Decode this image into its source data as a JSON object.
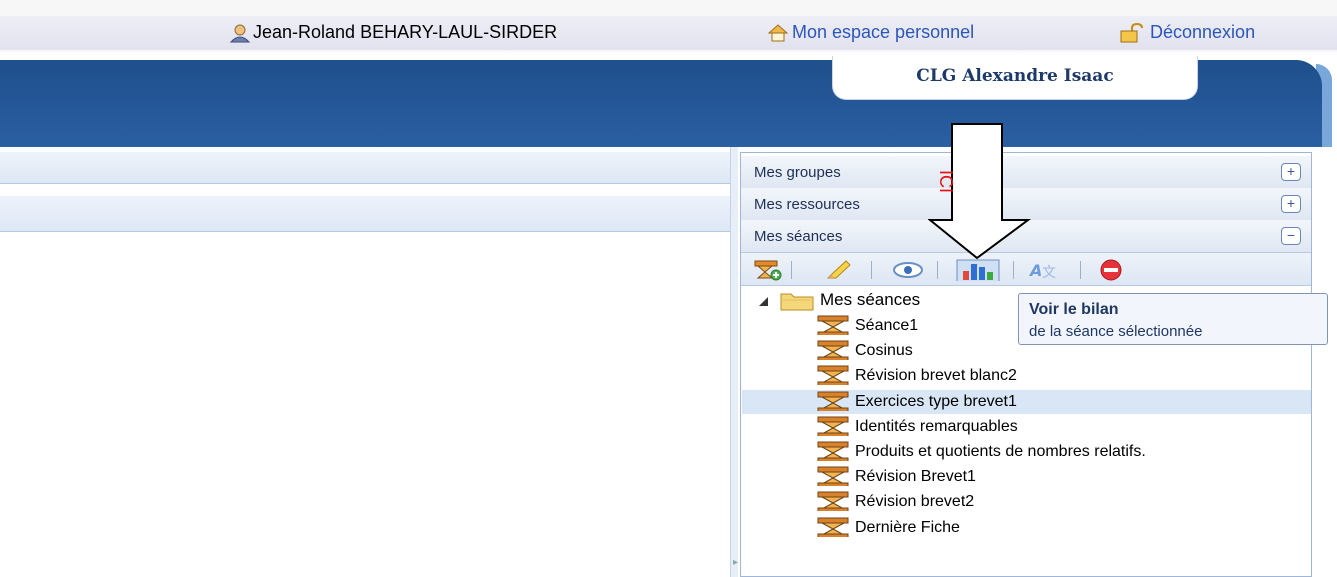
{
  "userbar": {
    "user_name": "Jean-Roland BEHARY-LAUL-SIRDER",
    "home_link": "Mon espace personnel",
    "logout_link": "Déconnexion"
  },
  "header": {
    "school": "CLG Alexandre Isaac"
  },
  "panel": {
    "sections": [
      {
        "title": "Mes groupes",
        "toggle": "+"
      },
      {
        "title": "Mes ressources",
        "toggle": "+"
      },
      {
        "title": "Mes séances",
        "toggle": "−"
      }
    ]
  },
  "toolbar": {
    "buttons": [
      "add-seance-icon",
      "edit-icon",
      "view-icon",
      "bilan-chart-icon",
      "translate-icon",
      "delete-icon"
    ]
  },
  "tree": {
    "root": "Mes séances",
    "items": [
      "Séance1",
      "Cosinus",
      "Révision brevet blanc2",
      "Exercices type brevet1",
      "Identités remarquables",
      "Produits et quotients de nombres relatifs.",
      "Révision Brevet1",
      "Révision brevet2",
      "Dernière Fiche"
    ],
    "selected_index": 3
  },
  "tooltip": {
    "title": "Voir le bilan",
    "subtitle": "de la séance sélectionnée"
  },
  "annotation": {
    "label": "ICI"
  },
  "colors": {
    "header_blue": "#1f4f8c",
    "annotation_red": "#e31212",
    "link_blue": "#2b56b8"
  }
}
